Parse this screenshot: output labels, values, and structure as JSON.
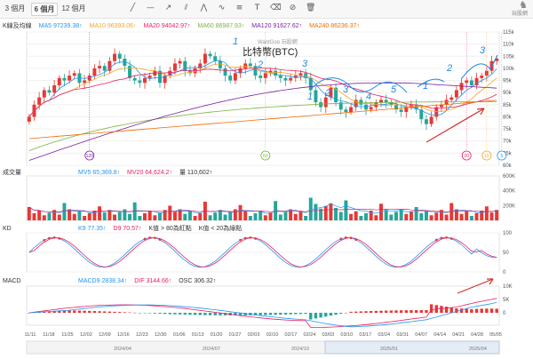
{
  "toolbar": {
    "tabs": [
      {
        "label": "3 個月",
        "active": false
      },
      {
        "label": "6 個月",
        "active": true
      },
      {
        "label": "12 個月",
        "active": false
      }
    ],
    "tools": [
      "line-tool-icon",
      "horizontal-line-icon",
      "ray-icon",
      "channel-icon",
      "pattern-icon",
      "wave-icon",
      "fibonacci-icon",
      "text-tool-icon",
      "eraser-icon",
      "hide-drawings-icon",
      "trash-icon"
    ],
    "logo": "玩股網"
  },
  "price_legend": {
    "label": "K線及均線",
    "ma5": "MA5 97239.38↑",
    "ma10": "MA10 96393.06↑",
    "ma20": "MA20 94042.97↑",
    "ma60": "MA60 86987.93↑",
    "ma120": "MA120 91627.62↑",
    "ma240": "MA240 86236.37↑"
  },
  "chart_title": "比特幣(BTC)",
  "watermark": "WantGoo 玩股網",
  "volume_legend": {
    "label": "成交量",
    "mv5": "MV5 65,369.8↑",
    "mv20": "MV20 64,624.2↑",
    "vol": "量 110,602↑"
  },
  "kd_legend": {
    "label": "KD",
    "k9": "K9 77.35↑",
    "d9": "D9 70.57↑",
    "note1": "K值 > 80為紅點",
    "note2": "K值 < 20為綠點"
  },
  "macd_legend": {
    "label": "MACD",
    "macd9": "MACD9 2838.34↑",
    "dif": "DIF 3144.66↑",
    "osc": "OSC 306.32↑"
  },
  "colors": {
    "up": "#e53935",
    "down": "#26a69a",
    "ma5": "#2196f3",
    "ma10": "#f5a623",
    "ma20": "#e91e63",
    "ma60": "#7cb342",
    "ma120": "#7b1fa2",
    "ma240": "#ef6c00",
    "k": "#2196f3",
    "d": "#e91e63",
    "dif": "#e91e63",
    "macd": "#2196f3"
  },
  "chart_data": [
    {
      "type": "candlestick",
      "title": "比特幣(BTC)",
      "x_ticks": [
        "11/11",
        "11/18",
        "11/25",
        "12/02",
        "12/09",
        "12/16",
        "12/23",
        "12/30",
        "01/06",
        "01/13",
        "01/20",
        "01/27",
        "02/03",
        "02/10",
        "02/17",
        "02/24",
        "03/03",
        "03/10",
        "03/17",
        "03/24",
        "03/31",
        "04/07",
        "04/14",
        "04/21",
        "04/28",
        "05/05"
      ],
      "ylim": [
        60,
        115
      ],
      "y_ticks": [
        "115k",
        "110k",
        "105k",
        "100k",
        "95k",
        "90k",
        "85k",
        "80k",
        "75k",
        "70k",
        "65k",
        "60k"
      ],
      "close_k": [
        80,
        85,
        88,
        91,
        90,
        93,
        96,
        95,
        97,
        98,
        94,
        95,
        97,
        100,
        101,
        99,
        103,
        106,
        104,
        101,
        96,
        95,
        94,
        96,
        97,
        99,
        94,
        97,
        99,
        102,
        103,
        99,
        98,
        100,
        102,
        106,
        105,
        103,
        100,
        97,
        95,
        98,
        100,
        102,
        101,
        97,
        96,
        98,
        99,
        97,
        96,
        95,
        96,
        97,
        98,
        96,
        91,
        86,
        84,
        88,
        92,
        86,
        83,
        82,
        84,
        87,
        85,
        83,
        84,
        86,
        87,
        86,
        85,
        83,
        82,
        84,
        85,
        83,
        79,
        77,
        80,
        84,
        85,
        87,
        88,
        91,
        94,
        95,
        93,
        96,
        97,
        99,
        103,
        104
      ],
      "ma_k": {
        "ma5_end": 97.24,
        "ma10_end": 96.39,
        "ma20_end": 94.04,
        "ma60_end": 86.99,
        "ma120_end": 91.63,
        "ma240_end": 86.24
      },
      "markers": [
        {
          "label": "120",
          "x_index": 12
        },
        {
          "label": "60",
          "x_index": 47
        },
        {
          "label": "20",
          "x_index": 87
        },
        {
          "label": "10",
          "x_index": 91
        },
        {
          "label": "5",
          "x_index": 94
        }
      ],
      "annotations": [
        "1",
        "2",
        "3",
        "1",
        "2",
        "3",
        "4",
        "5",
        "1",
        "2",
        "3"
      ]
    },
    {
      "type": "bar",
      "title": "成交量",
      "y_ticks": [
        "600K",
        "400K",
        "200K"
      ],
      "ylim": [
        0,
        600
      ]
    },
    {
      "type": "line",
      "title": "KD",
      "y_ticks": [
        "100",
        "50",
        "0"
      ],
      "ylim": [
        0,
        100
      ],
      "series": [
        {
          "name": "K9",
          "end": 77.35
        },
        {
          "name": "D9",
          "end": 70.57
        }
      ]
    },
    {
      "type": "line",
      "title": "MACD",
      "y_ticks": [
        "10K",
        "5K",
        "0"
      ],
      "series": [
        {
          "name": "MACD9",
          "end": 2838.34
        },
        {
          "name": "DIF",
          "end": 3144.66
        },
        {
          "name": "OSC",
          "end": 306.32
        }
      ]
    }
  ],
  "timeline": {
    "labels": [
      "2024/04",
      "2024/07",
      "2024/10",
      "2025/01",
      "2025/04"
    ]
  }
}
